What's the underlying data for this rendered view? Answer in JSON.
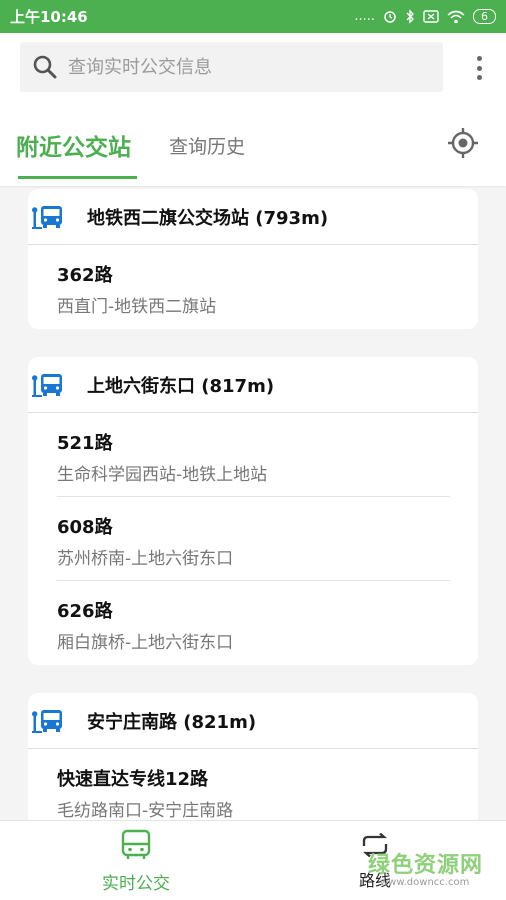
{
  "status_bar": {
    "time": "上午10:46",
    "signal_text": ".....",
    "battery": "6"
  },
  "search": {
    "placeholder": "查询实时公交信息"
  },
  "tabs": {
    "nearby": "附近公交站",
    "history": "查询历史"
  },
  "stations": [
    {
      "name": "地铁西二旗公交场站 (793m)",
      "routes": [
        {
          "name": "362路",
          "desc": "西直门-地铁西二旗站"
        }
      ]
    },
    {
      "name": "上地六街东口 (817m)",
      "routes": [
        {
          "name": "521路",
          "desc": "生命科学园西站-地铁上地站"
        },
        {
          "name": "608路",
          "desc": "苏州桥南-上地六街东口"
        },
        {
          "name": "626路",
          "desc": "厢白旗桥-上地六街东口"
        }
      ]
    },
    {
      "name": "安宁庄南路 (821m)",
      "routes": [
        {
          "name": "快速直达专线12路",
          "desc": "毛纺路南口-安宁庄南路"
        }
      ]
    }
  ],
  "bottom_nav": {
    "realtime": "实时公交",
    "route": "路线"
  },
  "watermark": {
    "text": "绿色资源网",
    "url": "www.downcc.com"
  },
  "colors": {
    "accent": "#4caf50",
    "bus_icon": "#1976d2"
  },
  "icons": {
    "search": "search-icon",
    "more": "more-vert-icon",
    "locate": "gps-locate-icon",
    "bus": "bus-stop-icon",
    "nav_bus": "bus-icon",
    "nav_route": "route-icon"
  }
}
